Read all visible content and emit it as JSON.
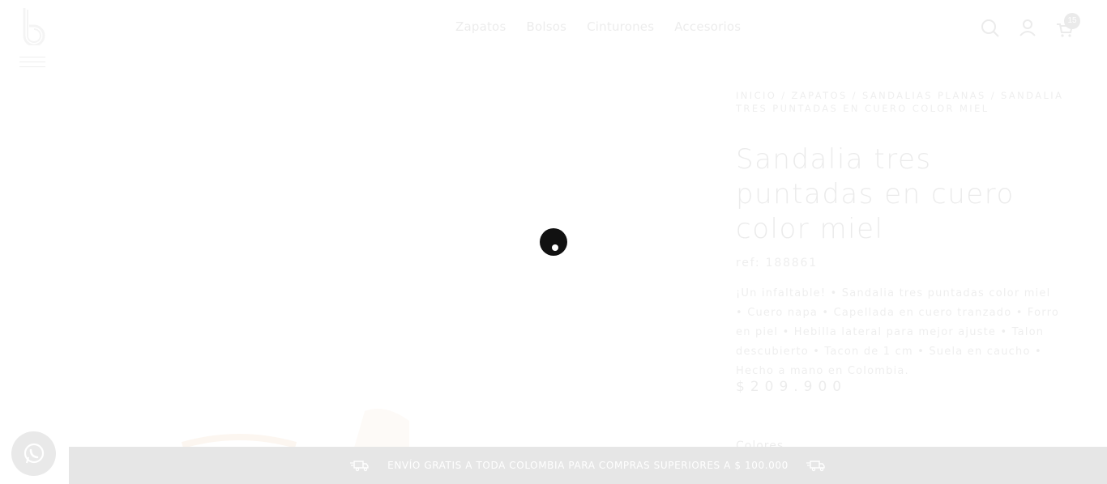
{
  "brand": {
    "logo_letter": "b"
  },
  "nav": {
    "items": [
      {
        "label": "Zapatos"
      },
      {
        "label": "Bolsos"
      },
      {
        "label": "Cinturones"
      },
      {
        "label": "Accesorios"
      }
    ]
  },
  "header_icons": {
    "search": "search-icon",
    "account": "user-icon",
    "cart": "cart-icon",
    "cart_count": "15"
  },
  "breadcrumb": {
    "items": [
      {
        "label": "INICIO"
      },
      {
        "label": "ZAPATOS"
      },
      {
        "label": "SANDALIAS PLANAS"
      },
      {
        "label": "SANDALIA TRES PUNTADAS EN CUERO COLOR MIEL"
      }
    ],
    "separator": "/"
  },
  "product": {
    "title": "Sandalia tres puntadas en cuero color miel",
    "ref": "ref: 188861",
    "description": "¡Un infaltable! • Sandalia tres puntadas color miel • Cuero napa • Capellada en cuero tranzado • Forro en piel • Hebilla lateral para mejor ajuste • Talon descubierto • Tacon de 1 cm • Suela en caucho • Hecho a mano en Colombia.",
    "price": "$209.900",
    "colors_label": "Colores"
  },
  "shipping_bar": {
    "text": "ENVÍO GRATIS A TODA COLOMBIA PARA COMPRAS SUPERIORES A $ 100.000"
  },
  "colors": {
    "overlay": "#ffffff",
    "loader": "#111111",
    "bar": "#e6e6e6"
  }
}
